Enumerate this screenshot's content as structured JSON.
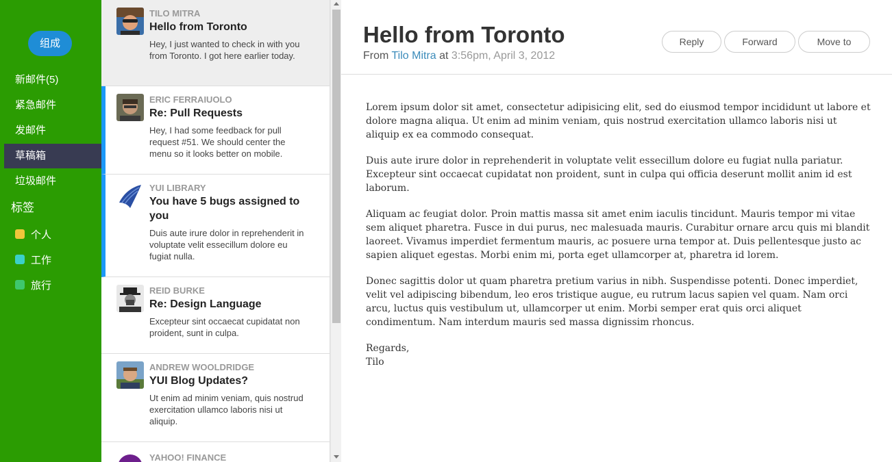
{
  "nav": {
    "compose": "组成",
    "items": [
      {
        "label": "新邮件",
        "count": "(5)"
      },
      {
        "label": "紧急邮件"
      },
      {
        "label": "发邮件"
      },
      {
        "label": "草稿箱"
      },
      {
        "label": "垃圾邮件"
      }
    ],
    "labels_heading": "标签",
    "labels": [
      {
        "name": "个人",
        "color": "#f0c63b"
      },
      {
        "name": "工作",
        "color": "#3bd0c9"
      },
      {
        "name": "旅行",
        "color": "#3fc76e"
      }
    ]
  },
  "list": [
    {
      "sender": "Tilo Mitra",
      "subject": "Hello from Toronto",
      "excerpt": "Hey, I just wanted to check in with you from Toronto. I got here earlier today."
    },
    {
      "sender": "Eric Ferraiuolo",
      "subject": "Re: Pull Requests",
      "excerpt": "Hey, I had some feedback for pull request #51. We should center the menu so it looks better on mobile."
    },
    {
      "sender": "YUI Library",
      "subject": "You have 5 bugs assigned to you",
      "excerpt": "Duis aute irure dolor in reprehenderit in voluptate velit essecillum dolore eu fugiat nulla."
    },
    {
      "sender": "Reid Burke",
      "subject": "Re: Design Language",
      "excerpt": "Excepteur sint occaecat cupidatat non proident, sunt in culpa."
    },
    {
      "sender": "Andrew Wooldridge",
      "subject": "YUI Blog Updates?",
      "excerpt": "Ut enim ad minim veniam, quis nostrud exercitation ullamco laboris nisi ut aliquip."
    },
    {
      "sender": "Yahoo! Finance",
      "subject": "",
      "excerpt": ""
    }
  ],
  "message": {
    "title": "Hello from Toronto",
    "from_prefix": "From",
    "from_name": "Tilo Mitra",
    "at": "at",
    "date": "3:56pm, April 3, 2012",
    "buttons": {
      "reply": "Reply",
      "forward": "Forward",
      "move": "Move to"
    },
    "paragraphs": [
      "Lorem ipsum dolor sit amet, consectetur adipisicing elit, sed do eiusmod tempor incididunt ut labore et dolore magna aliqua. Ut enim ad minim veniam, quis nostrud exercitation ullamco laboris nisi ut aliquip ex ea commodo consequat.",
      "Duis aute irure dolor in reprehenderit in voluptate velit essecillum dolore eu fugiat nulla pariatur. Excepteur sint occaecat cupidatat non proident, sunt in culpa qui officia deserunt mollit anim id est laborum.",
      "Aliquam ac feugiat dolor. Proin mattis massa sit amet enim iaculis tincidunt. Mauris tempor mi vitae sem aliquet pharetra. Fusce in dui purus, nec malesuada mauris. Curabitur ornare arcu quis mi blandit laoreet. Vivamus imperdiet fermentum mauris, ac posuere urna tempor at. Duis pellentesque justo ac sapien aliquet egestas. Morbi enim mi, porta eget ullamcorper at, pharetra id lorem.",
      "Donec sagittis dolor ut quam pharetra pretium varius in nibh. Suspendisse potenti. Donec imperdiet, velit vel adipiscing bibendum, leo eros tristique augue, eu rutrum lacus sapien vel quam. Nam orci arcu, luctus quis vestibulum ut, ullamcorper ut enim. Morbi semper erat quis orci aliquet condimentum. Nam interdum mauris sed massa dignissim rhoncus."
    ],
    "regards": "Regards,",
    "signature": "Tilo"
  }
}
